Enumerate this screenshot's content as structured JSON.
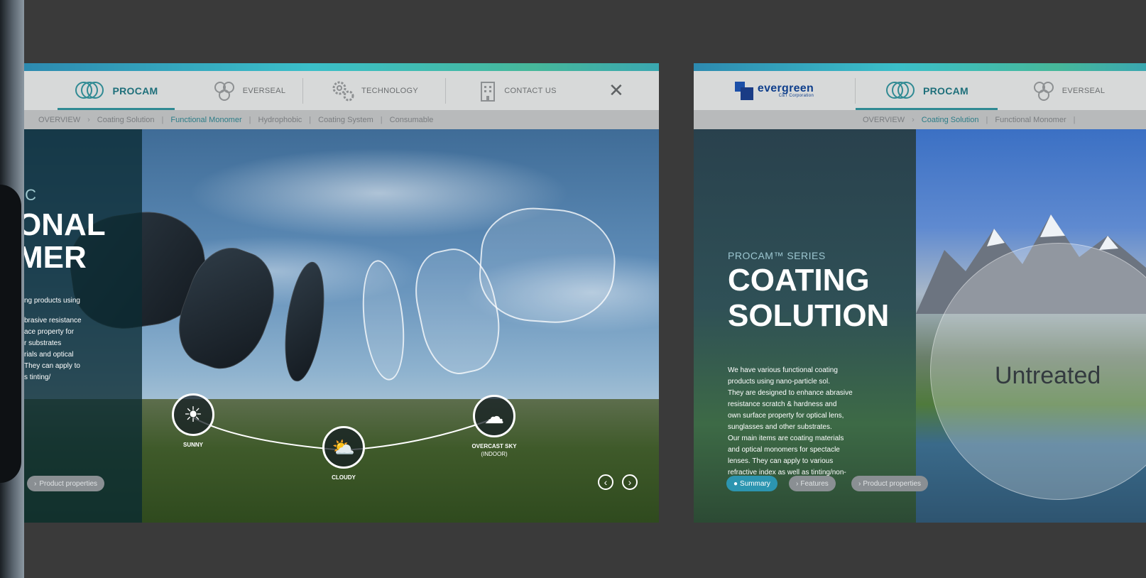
{
  "left_slide": {
    "nav": {
      "brand": "PROCAM",
      "evers": "EVERSEAL",
      "tech": "TECHNOLOGY",
      "contact": "CONTACT US"
    },
    "subnav": [
      "OVERVIEW",
      "Coating Solution",
      "Functional Monomer",
      "Hydrophobic",
      "Coating System",
      "Consumable"
    ],
    "hero": {
      "kicker": "IC",
      "title_line1": "ONAL",
      "title_line2": "MER",
      "desc_a": "ng products using",
      "desc_b": "brasive resistance\nace property for\nr substrates\nrials and optical\nThey can apply to\ns tinting/"
    },
    "weather": {
      "sunny": "SUNNY",
      "cloudy": "CLOUDY",
      "overcast": "OVERCAST SKY",
      "overcast_sub": "(INDOOR)"
    },
    "pill": "Product properties"
  },
  "right_slide": {
    "nav": {
      "logo": "evergreen",
      "logo_sub": "C&T Corporation",
      "brand": "PROCAM",
      "evers": "EVERSEAL"
    },
    "subnav": [
      "OVERVIEW",
      "Coating Solution",
      "Functional Monomer"
    ],
    "hero": {
      "series": "PROCAM™ SERIES",
      "title_line1": "COATING",
      "title_line2": "SOLUTION",
      "desc": "We have various functional coating\nproducts using nano-particle sol.\nThey are designed to enhance abrasive\nresistance scratch & hardness and\nown surface property for optical lens,\nsunglasses and other substrates.\nOur main items are coating materials\nand optical monomers for spectacle\nlenses. They can apply to various\nrefractive index as well as tinting/non-\ntinting lens.",
      "untreated": "Untreated"
    },
    "pills": {
      "summary": "Summary",
      "features": "Features",
      "properties": "Product properties"
    }
  },
  "colors": {
    "background": "#3a3a3a",
    "accent": "#2f8a93",
    "pill_active": "#2c95b0",
    "logo_blue": "#1b4fa8"
  }
}
